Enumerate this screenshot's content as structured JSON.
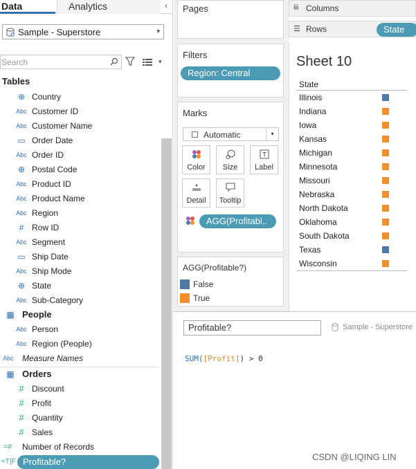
{
  "tabs": {
    "data": "Data",
    "analytics": "Analytics",
    "collapse": "‹"
  },
  "datasource": {
    "label": "Sample - Superstore",
    "arrow": "▾"
  },
  "search": {
    "placeholder": "Search"
  },
  "tables_header": "Tables",
  "orders_fields": [
    {
      "type": "geo",
      "name": "Country"
    },
    {
      "type": "abc",
      "name": "Customer ID"
    },
    {
      "type": "abc",
      "name": "Customer Name"
    },
    {
      "type": "date",
      "name": "Order Date"
    },
    {
      "type": "abc",
      "name": "Order ID"
    },
    {
      "type": "geo",
      "name": "Postal Code"
    },
    {
      "type": "abc",
      "name": "Product ID"
    },
    {
      "type": "abc",
      "name": "Product Name"
    },
    {
      "type": "abc",
      "name": "Region"
    },
    {
      "type": "num",
      "name": "Row ID"
    },
    {
      "type": "abc",
      "name": "Segment"
    },
    {
      "type": "date",
      "name": "Ship Date"
    },
    {
      "type": "abc",
      "name": "Ship Mode"
    },
    {
      "type": "geo",
      "name": "State"
    },
    {
      "type": "abc",
      "name": "Sub-Category"
    }
  ],
  "people": {
    "title": "People",
    "fields": [
      "Person",
      "Region (People)"
    ]
  },
  "measure_names": "Measure Names",
  "orders": {
    "title": "Orders",
    "fields": [
      "Discount",
      "Profit",
      "Quantity",
      "Sales"
    ]
  },
  "number_of_records": "Number of Records",
  "profitable_pill": "Profitable?",
  "type_icons": {
    "abc": "Abc",
    "num": "#",
    "date": "▭",
    "geo": "⊕"
  },
  "pages": {
    "title": "Pages"
  },
  "filters": {
    "title": "Filters",
    "pill": "Region: Central"
  },
  "marks": {
    "title": "Marks",
    "type": "Automatic",
    "buttons": [
      "Color",
      "Size",
      "Label",
      "Detail",
      "Tooltip"
    ],
    "pill": "AGG(Profitabl.."
  },
  "legend": {
    "title": "AGG(Profitable?)",
    "items": [
      {
        "label": "False",
        "color": "#4e79a7"
      },
      {
        "label": "True",
        "color": "#f28e2b"
      }
    ]
  },
  "columns": {
    "label": "Columns"
  },
  "rows": {
    "label": "Rows",
    "pill": "State"
  },
  "sheet": {
    "title": "Sheet 10",
    "header": "State",
    "rows": [
      {
        "state": "Illinois",
        "profitable": false
      },
      {
        "state": "Indiana",
        "profitable": true
      },
      {
        "state": "Iowa",
        "profitable": true
      },
      {
        "state": "Kansas",
        "profitable": true
      },
      {
        "state": "Michigan",
        "profitable": true
      },
      {
        "state": "Minnesota",
        "profitable": true
      },
      {
        "state": "Missouri",
        "profitable": true
      },
      {
        "state": "Nebraska",
        "profitable": true
      },
      {
        "state": "North Dakota",
        "profitable": true
      },
      {
        "state": "Oklahoma",
        "profitable": true
      },
      {
        "state": "South Dakota",
        "profitable": true
      },
      {
        "state": "Texas",
        "profitable": false
      },
      {
        "state": "Wisconsin",
        "profitable": true
      }
    ]
  },
  "calc": {
    "name": "Profitable?",
    "datasource": "Sample - Superstore",
    "formula": {
      "fn": "SUM(",
      "field": "[Profit]",
      "rest": ") > 0"
    }
  },
  "watermark": "CSDN @LIQING LIN",
  "colors": {
    "pill": "#4b9bb5",
    "false": "#4e79a7",
    "true": "#f28e2b",
    "accent": "#2f6db5"
  }
}
